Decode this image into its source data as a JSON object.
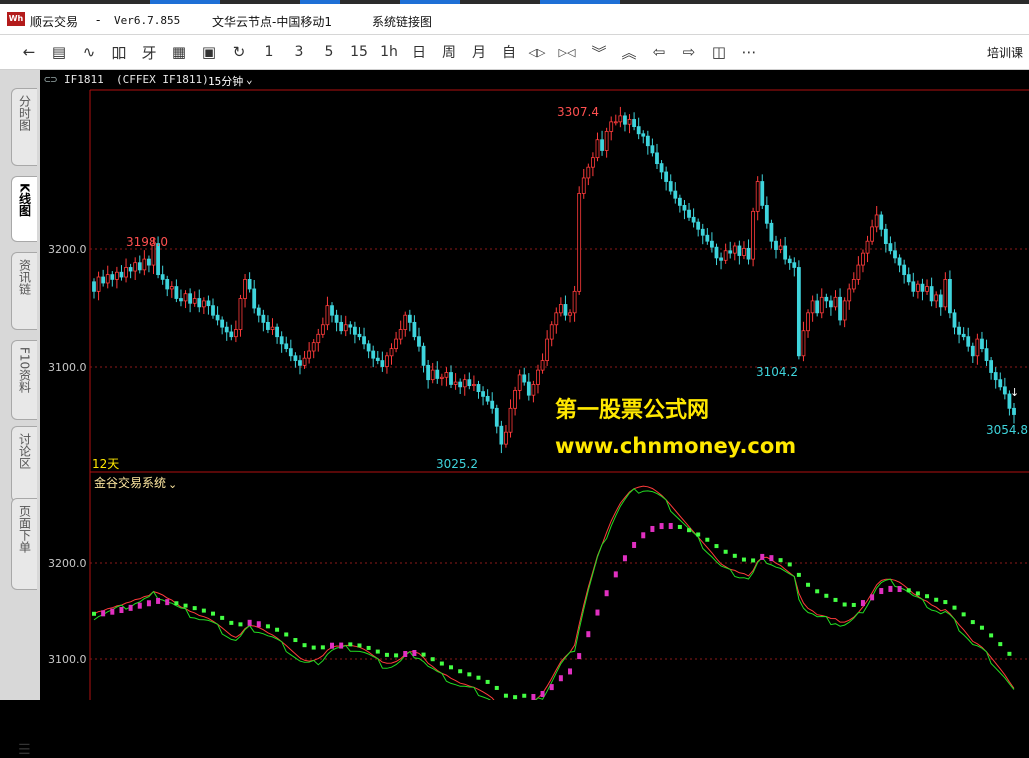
{
  "window": {
    "app_name": "顺云交易",
    "separator": "-",
    "version": "Ver6.7.855",
    "node": "文华云节点-中国移动1",
    "system": "系统链接图"
  },
  "toolbar": {
    "buttons": [
      {
        "name": "back-arrow-icon",
        "glyph": "←"
      },
      {
        "name": "quote-list-icon",
        "glyph": "▤"
      },
      {
        "name": "line-chart-icon",
        "glyph": "∿"
      },
      {
        "name": "candle-chart-icon",
        "glyph": "吅"
      },
      {
        "name": "analysis-icon",
        "glyph": "⽛"
      },
      {
        "name": "template-icon",
        "glyph": "▦"
      },
      {
        "name": "save-icon",
        "glyph": "▣"
      },
      {
        "name": "refresh-icon",
        "glyph": "↻"
      }
    ],
    "periods": [
      "1",
      "3",
      "5",
      "15",
      "1h",
      "日",
      "周",
      "月",
      "自"
    ],
    "nav_buttons": [
      {
        "name": "zoom-in-icon",
        "glyph": "◁▷"
      },
      {
        "name": "zoom-out-icon",
        "glyph": "▷◁"
      },
      {
        "name": "chevron-down-double-icon",
        "glyph": "︾"
      },
      {
        "name": "chevron-up-double-icon",
        "glyph": "︽"
      },
      {
        "name": "arrow-left-icon",
        "glyph": "⇦"
      },
      {
        "name": "arrow-right-icon",
        "glyph": "⇨"
      },
      {
        "name": "layout-icon",
        "glyph": "◫"
      },
      {
        "name": "more-icon",
        "glyph": "⋯"
      }
    ],
    "right_label": "培训课"
  },
  "sidebar": {
    "tabs": [
      "分时图",
      "K线图",
      "资讯链",
      "F10资料",
      "讨论区",
      "页面下单"
    ],
    "active": "K线图"
  },
  "symbol_bar": {
    "symbol": "IF1811",
    "exchange": "(CFFEX IF1811)",
    "period": "15分钟"
  },
  "colors": {
    "up": "#ff3b3b",
    "down": "#3fd4dc",
    "grid": "#8b1a1a",
    "frame": "#b01010",
    "label_red": "#ff5050",
    "label_cyan": "#3fd4dc",
    "axis_text": "#c8c8c8",
    "green_line": "#22dd22",
    "green_squares": "#44ff44",
    "magenta": "#e030c0",
    "watermark": "#ffe800"
  },
  "main_panel": {
    "y_ticks": [
      "3200.0",
      "3100.0"
    ],
    "annotations": {
      "high": "3307.4",
      "left_high": "3198.0",
      "low": "3025.2",
      "mid_low": "3104.2",
      "last": "3054.8"
    },
    "period_label": "12天"
  },
  "indicator_panel": {
    "name": "金谷交易系统",
    "y_ticks": [
      "3200.0",
      "3100.0"
    ]
  },
  "watermark": {
    "line1": "第一股票公式网",
    "line2": "www.chnmoney.com"
  },
  "chart_data": {
    "type": "candlestick",
    "series": [
      {
        "closes": [
          3158,
          3170,
          3165,
          3172,
          3168,
          3174,
          3170,
          3178,
          3175,
          3182,
          3176,
          3185,
          3180,
          3198,
          3172,
          3168,
          3160,
          3162,
          3152,
          3150,
          3156,
          3148,
          3152,
          3145,
          3150,
          3146,
          3138,
          3134,
          3128,
          3124,
          3120,
          3126,
          3152,
          3168,
          3160,
          3144,
          3138,
          3132,
          3126,
          3128,
          3120,
          3114,
          3110,
          3104,
          3100,
          3096,
          3102,
          3108,
          3115,
          3122,
          3130,
          3146,
          3138,
          3132,
          3125,
          3130,
          3128,
          3122,
          3120,
          3114,
          3108,
          3102,
          3100,
          3095,
          3104,
          3110,
          3118,
          3126,
          3138,
          3132,
          3120,
          3112,
          3096,
          3084,
          3092,
          3085,
          3086,
          3090,
          3080,
          3082,
          3078,
          3084,
          3079,
          3080,
          3074,
          3070,
          3066,
          3060,
          3045,
          3030,
          3040,
          3060,
          3075,
          3088,
          3082,
          3071,
          3080,
          3092,
          3100,
          3118,
          3130,
          3140,
          3147,
          3138,
          3140,
          3158,
          3240,
          3253,
          3262,
          3270,
          3285,
          3276,
          3292,
          3300,
          3300,
          3305,
          3298,
          3302,
          3296,
          3290,
          3288,
          3280,
          3274,
          3265,
          3258,
          3250,
          3242,
          3236,
          3230,
          3226,
          3220,
          3216,
          3210,
          3205,
          3200,
          3195,
          3186,
          3184,
          3192,
          3190,
          3196,
          3188,
          3194,
          3185,
          3225,
          3250,
          3230,
          3215,
          3200,
          3193,
          3196,
          3185,
          3182,
          3178,
          3104,
          3125,
          3140,
          3150,
          3140,
          3153,
          3150,
          3145,
          3153,
          3134,
          3150,
          3160,
          3168,
          3180,
          3190,
          3200,
          3212,
          3222,
          3210,
          3198,
          3192,
          3186,
          3180,
          3172,
          3166,
          3158,
          3164,
          3158,
          3162,
          3150,
          3155,
          3145,
          3168,
          3140,
          3128,
          3122,
          3120,
          3112,
          3104,
          3118,
          3110,
          3100,
          3090,
          3084,
          3078,
          3072,
          3060,
          3054.8
        ]
      }
    ],
    "y_range": [
      3010,
      3325
    ],
    "high": 3307.4,
    "low": 3025.2,
    "last": 3054.8
  }
}
